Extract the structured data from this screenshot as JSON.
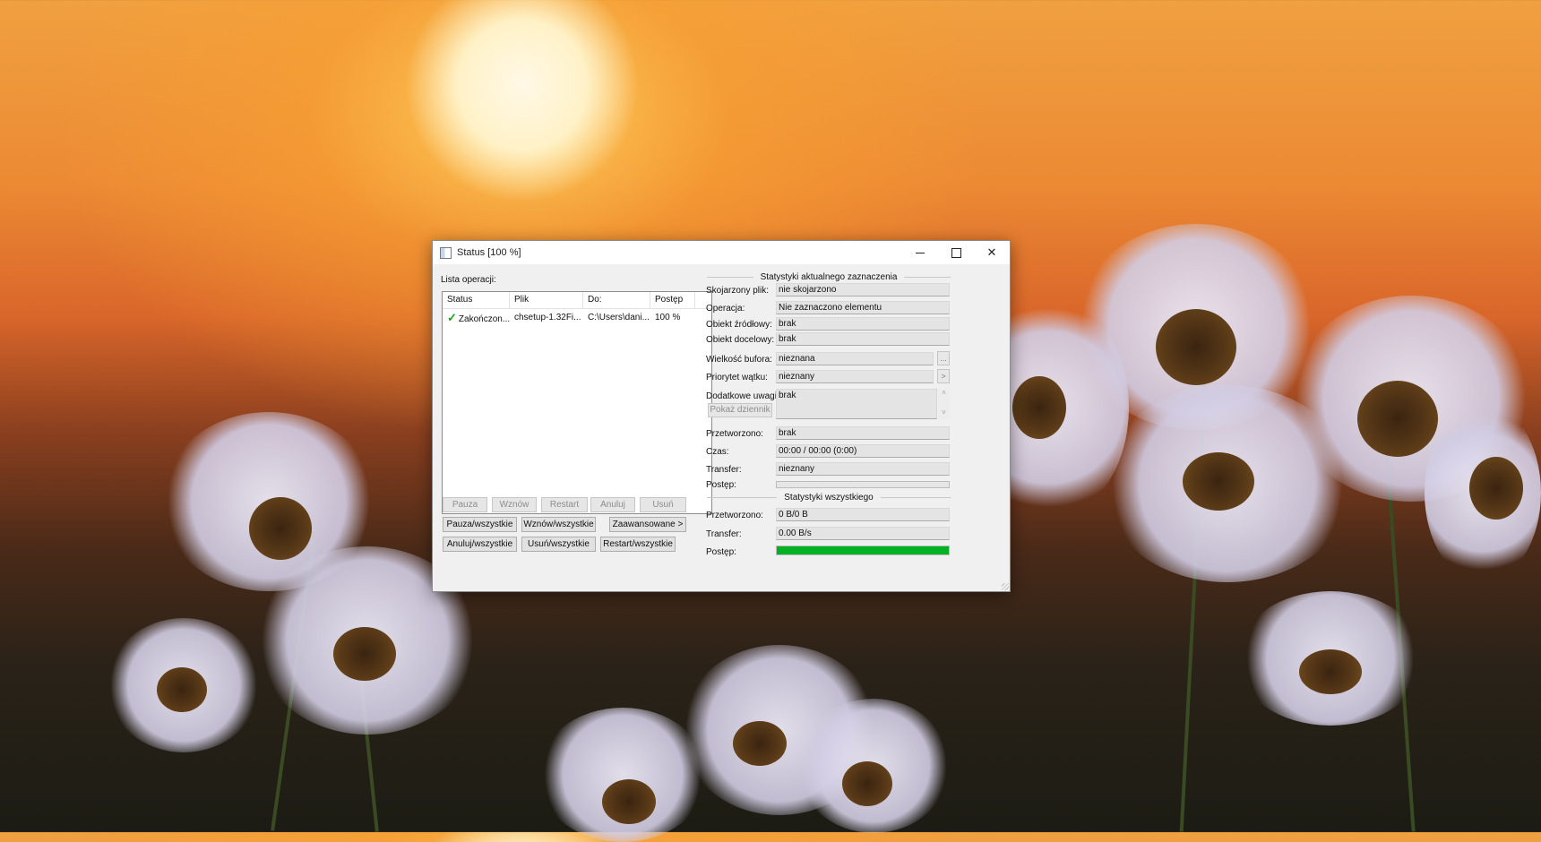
{
  "window": {
    "title": "Status [100 %]"
  },
  "left": {
    "list_label": "Lista operacji:",
    "columns": [
      "Status",
      "Plik",
      "Do:",
      "Postęp"
    ],
    "rows": [
      {
        "status": "Zakończon...",
        "file": "chsetup-1.32Fi...",
        "dest": "C:\\Users\\dani...",
        "progress": "100 %"
      }
    ],
    "buttons_row1": [
      "Pauza",
      "Wznów",
      "Restart",
      "Anuluj",
      "Usuń"
    ],
    "buttons_row2": [
      "Pauza/wszystkie",
      "Wznów/wszystkie",
      "Zaawansowane >"
    ],
    "buttons_row3": [
      "Anuluj/wszystkie",
      "Usuń/wszystkie",
      "Restart/wszystkie"
    ]
  },
  "current": {
    "section_title": "Statystyki aktualnego zaznaczenia",
    "associated_label": "Skojarzony plik:",
    "associated_value": "nie skojarzono",
    "operation_label": "Operacja:",
    "operation_value": "Nie zaznaczono elementu",
    "source_label": "Obiekt źródłowy:",
    "source_value": "brak",
    "target_label": "Obiekt docelowy:",
    "target_value": "brak",
    "buffer_label": "Wielkość bufora:",
    "buffer_value": "nieznana",
    "buffer_btn": "...",
    "priority_label": "Priorytet wątku:",
    "priority_value": "nieznany",
    "priority_btn": ">",
    "notes_label": "Dodatkowe uwagi:",
    "notes_value": "brak",
    "show_log": "Pokaż dziennik",
    "processed_label": "Przetworzono:",
    "processed_value": "brak",
    "time_label": "Czas:",
    "time_value": "00:00 / 00:00 (0:00)",
    "transfer_label": "Transfer:",
    "transfer_value": "nieznany",
    "progress_label": "Postęp:",
    "progress_fraction": 0
  },
  "total": {
    "section_title": "Statystyki wszystkiego",
    "processed_label": "Przetworzono:",
    "processed_value": "0 B/0 B",
    "transfer_label": "Transfer:",
    "transfer_value": "0.00 B/s",
    "progress_label": "Postęp:",
    "progress_fraction": 1.0,
    "progress_color": "#06b025"
  }
}
